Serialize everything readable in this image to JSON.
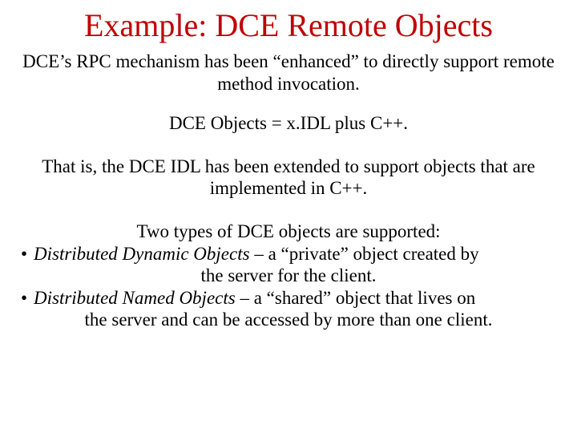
{
  "title": "Example: DCE Remote Objects",
  "p1": "DCE’s RPC mechanism has been “enhanced” to directly support remote method invocation.",
  "p2": "DCE Objects = x.IDL plus C++.",
  "p3": "That is, the DCE IDL has been extended to support objects that are implemented in C++.",
  "p4": "Two types of DCE objects are supported:",
  "bullets": [
    {
      "name": "Distributed Dynamic Objects",
      "desc_first": " – a “private” object created by",
      "desc_cont": "the server for the client."
    },
    {
      "name": "Distributed Named Objects",
      "desc_first": " – a “shared” object that lives on",
      "desc_cont": "the server and can be accessed by more than one client."
    }
  ]
}
